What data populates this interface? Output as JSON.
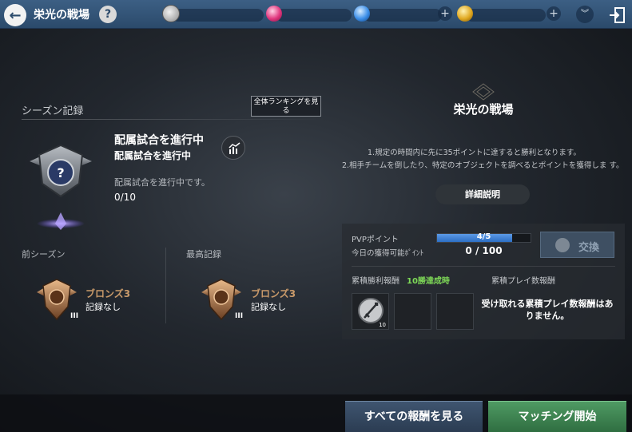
{
  "header": {
    "title": "栄光の戦場",
    "help_label": "?"
  },
  "season": {
    "title": "シーズン記録",
    "ranking_button": "全体ランキングを見る",
    "placement_title": "配属試合を進行中",
    "placement_subtitle": "配属試合を進行中",
    "placement_desc": "配属試合を進行中です。",
    "placement_count": "0/10",
    "badge_glyph": "?",
    "prev_label": "前シーズン",
    "best_label": "最高記録",
    "prev_rank": "ブロンズ3",
    "prev_record": "記録なし",
    "prev_tier": "III",
    "best_rank": "ブロンズ3",
    "best_record": "記録なし",
    "best_tier": "III"
  },
  "info": {
    "title": "栄光の戦場",
    "rule1": "1.規定の時間内に先に35ポイントに達すると勝利となります。",
    "rule2": "2.相手チームを倒したり、特定のオブジェクトを調べるとポイントを獲得しま す。",
    "detail_button": "詳細説明"
  },
  "pvp": {
    "points_label": "PVPポイント",
    "points_value": "4/5",
    "points_fraction": 0.8,
    "today_label": "今日の獲得可能ﾎﾟｲﾝﾄ",
    "today_value": "0 / 100",
    "exchange_button": "交換",
    "win_reward_label": "累積勝利報酬",
    "win_condition": "10勝達成時",
    "play_reward_label": "累積プレイ数報酬",
    "reward_item_count": "10",
    "no_reward_text": "受け取れる累積プレイ数報酬はありません。"
  },
  "footer": {
    "all_rewards_button": "すべての報酬を見る",
    "match_button": "マッチング開始"
  },
  "colors": {
    "topbar": "#2b4a6b",
    "rank_bronze": "#c99a6a",
    "win_condition": "#7ed957",
    "bar_fill": "#2d6fc4",
    "match_button": "#2f6e41"
  }
}
